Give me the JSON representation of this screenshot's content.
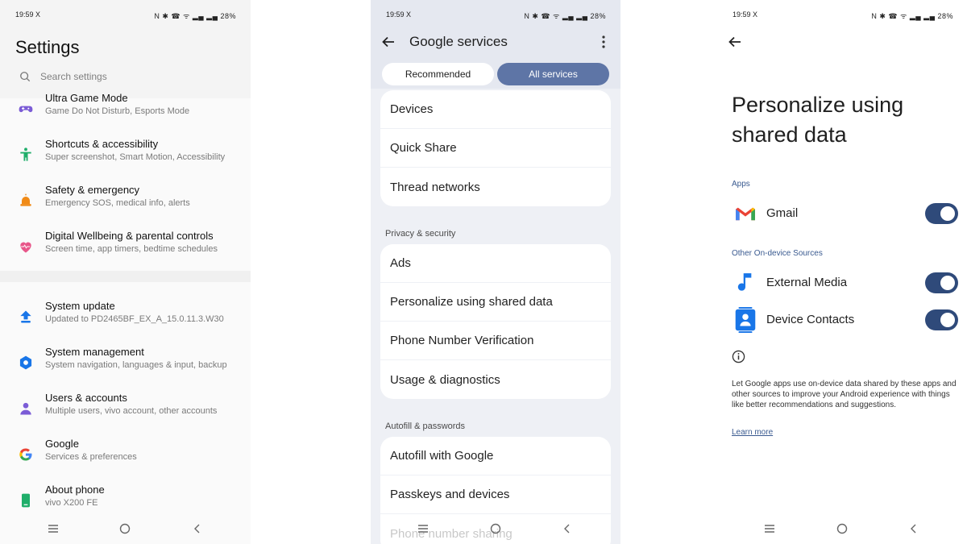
{
  "colors": {
    "accent": "#5e75a6",
    "toggle_on": "#2f4a7a",
    "link": "#3a5a90"
  },
  "status_bar": {
    "time": "19:59",
    "x_icon": "X",
    "indicators": "N ✱ ☎ ᯤ ▂▄ ▂▄",
    "battery": "28%"
  },
  "phone1": {
    "title": "Settings",
    "search_placeholder": "Search settings",
    "items": [
      {
        "title": "Ultra Game Mode",
        "subtitle": "Game Do Not Disturb, Esports Mode",
        "icon": "gamepad-icon"
      },
      {
        "title": "Shortcuts & accessibility",
        "subtitle": "Super screenshot, Smart Motion, Accessibility",
        "icon": "accessibility-icon"
      },
      {
        "title": "Safety & emergency",
        "subtitle": "Emergency SOS, medical info, alerts",
        "icon": "siren-icon"
      },
      {
        "title": "Digital Wellbeing & parental controls",
        "subtitle": "Screen time, app timers, bedtime schedules",
        "icon": "heart-icon"
      },
      {
        "title": "System update",
        "subtitle": "Updated to PD2465BF_EX_A_15.0.11.3.W30",
        "icon": "update-arrow-icon"
      },
      {
        "title": "System management",
        "subtitle": "System navigation, languages & input, backup",
        "icon": "hexagon-gear-icon"
      },
      {
        "title": "Users & accounts",
        "subtitle": "Multiple users, vivo account, other accounts",
        "icon": "user-icon"
      },
      {
        "title": "Google",
        "subtitle": "Services & preferences",
        "icon": "google-icon"
      },
      {
        "title": "About phone",
        "subtitle": "vivo X200 FE",
        "icon": "phone-icon"
      }
    ]
  },
  "phone2": {
    "title": "Google services",
    "tabs": [
      "Recommended",
      "All services"
    ],
    "group1": [
      "Devices",
      "Quick Share",
      "Thread networks"
    ],
    "section_privacy": "Privacy & security",
    "group2": [
      "Ads",
      "Personalize using shared data",
      "Phone Number Verification",
      "Usage & diagnostics"
    ],
    "section_autofill": "Autofill & passwords",
    "group3": [
      "Autofill with Google",
      "Passkeys and devices"
    ],
    "partial_item": "Phone number sharing"
  },
  "phone3": {
    "title": "Personalize using shared data",
    "section_apps": "Apps",
    "apps": [
      {
        "label": "Gmail",
        "icon": "gmail-icon",
        "enabled": true
      }
    ],
    "section_other": "Other On-device Sources",
    "sources": [
      {
        "label": "External Media",
        "icon": "music-note-icon",
        "enabled": true
      },
      {
        "label": "Device Contacts",
        "icon": "contacts-icon",
        "enabled": true
      }
    ],
    "description": "Let Google apps use on-device data shared by these apps and other sources to improve your Android experience with things like better recommendations and suggestions.",
    "learn_more": "Learn more"
  }
}
